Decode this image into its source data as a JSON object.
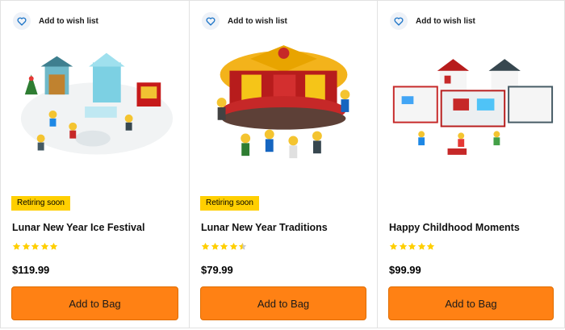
{
  "colors": {
    "accent": "#ff8114",
    "badge": "#ffcf00",
    "star": "#ffcf00",
    "star_empty": "#c8c8c8",
    "wish_bg": "#eef2f8",
    "heart": "#1a73c7"
  },
  "products": [
    {
      "wish_label": "Add to wish list",
      "badge": "Retiring soon",
      "title": "Lunar New Year Ice Festival",
      "rating": 5,
      "price": "$119.99",
      "button": "Add to Bag",
      "icon": "heart-icon"
    },
    {
      "wish_label": "Add to wish list",
      "badge": "Retiring soon",
      "title": "Lunar New Year Traditions",
      "rating": 4.5,
      "price": "$79.99",
      "button": "Add to Bag",
      "icon": "heart-icon"
    },
    {
      "wish_label": "Add to wish list",
      "badge": "",
      "title": "Happy Childhood Moments",
      "rating": 5,
      "price": "$99.99",
      "button": "Add to Bag",
      "icon": "heart-icon"
    }
  ]
}
